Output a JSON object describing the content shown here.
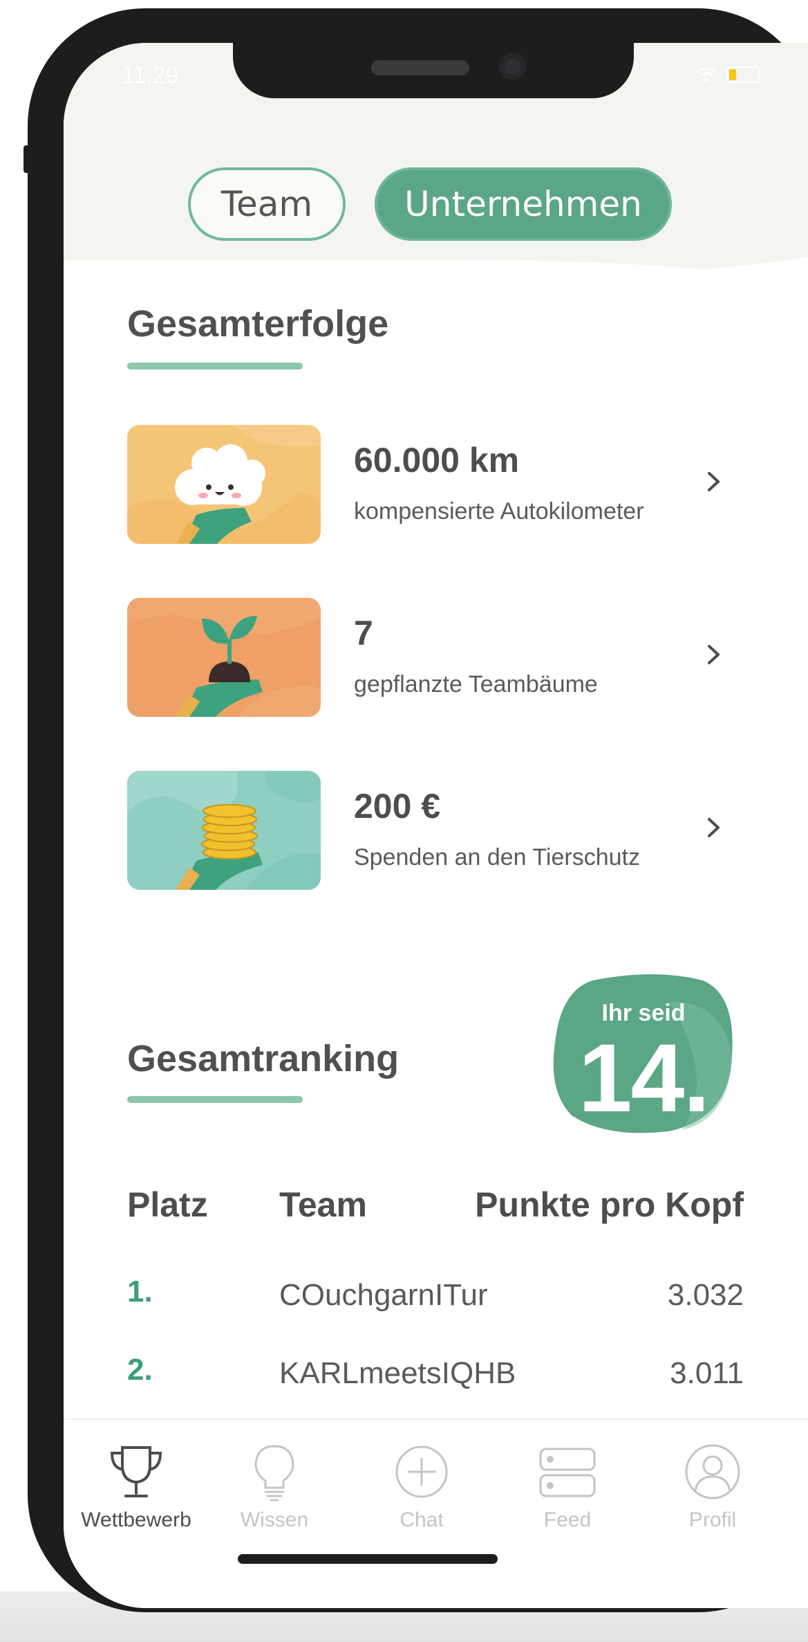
{
  "status": {
    "time": "11:29"
  },
  "toggle": {
    "team_label": "Team",
    "company_label": "Unternehmen"
  },
  "achievements": {
    "title": "Gesamterfolge",
    "items": [
      {
        "value": "60.000 km",
        "label": "kompensierte Autokilometer",
        "icon": "cloud-icon"
      },
      {
        "value": "7",
        "label": "gepflanzte Teambäume",
        "icon": "sprout-icon"
      },
      {
        "value": "200 €",
        "label": "Spenden an den Tierschutz",
        "icon": "coins-icon"
      }
    ]
  },
  "ranking": {
    "title": "Gesamtranking",
    "badge_small": "Ihr seid",
    "badge_big": "14.",
    "columns": [
      "Platz",
      "Team",
      "Punkte pro Kopf"
    ],
    "rows": [
      {
        "place": "1.",
        "team": "COuchgarnITur",
        "points": "3.032"
      },
      {
        "place": "2.",
        "team": "KARLmeetsIQHB",
        "points": "3.011"
      }
    ]
  },
  "tabs": [
    {
      "label": "Wettbewerb",
      "icon": "trophy-icon",
      "active": true
    },
    {
      "label": "Wissen",
      "icon": "lightbulb-icon",
      "active": false
    },
    {
      "label": "Chat",
      "icon": "plus-circle-icon",
      "active": false
    },
    {
      "label": "Feed",
      "icon": "feed-icon",
      "active": false
    },
    {
      "label": "Profil",
      "icon": "profile-icon",
      "active": false
    }
  ],
  "colors": {
    "accent": "#5aa685",
    "accent_light": "#8cc7ad",
    "rank_number": "#3d9d79",
    "tab_active": "#4d4d4d",
    "tab_inactive": "#c4c4c4"
  }
}
